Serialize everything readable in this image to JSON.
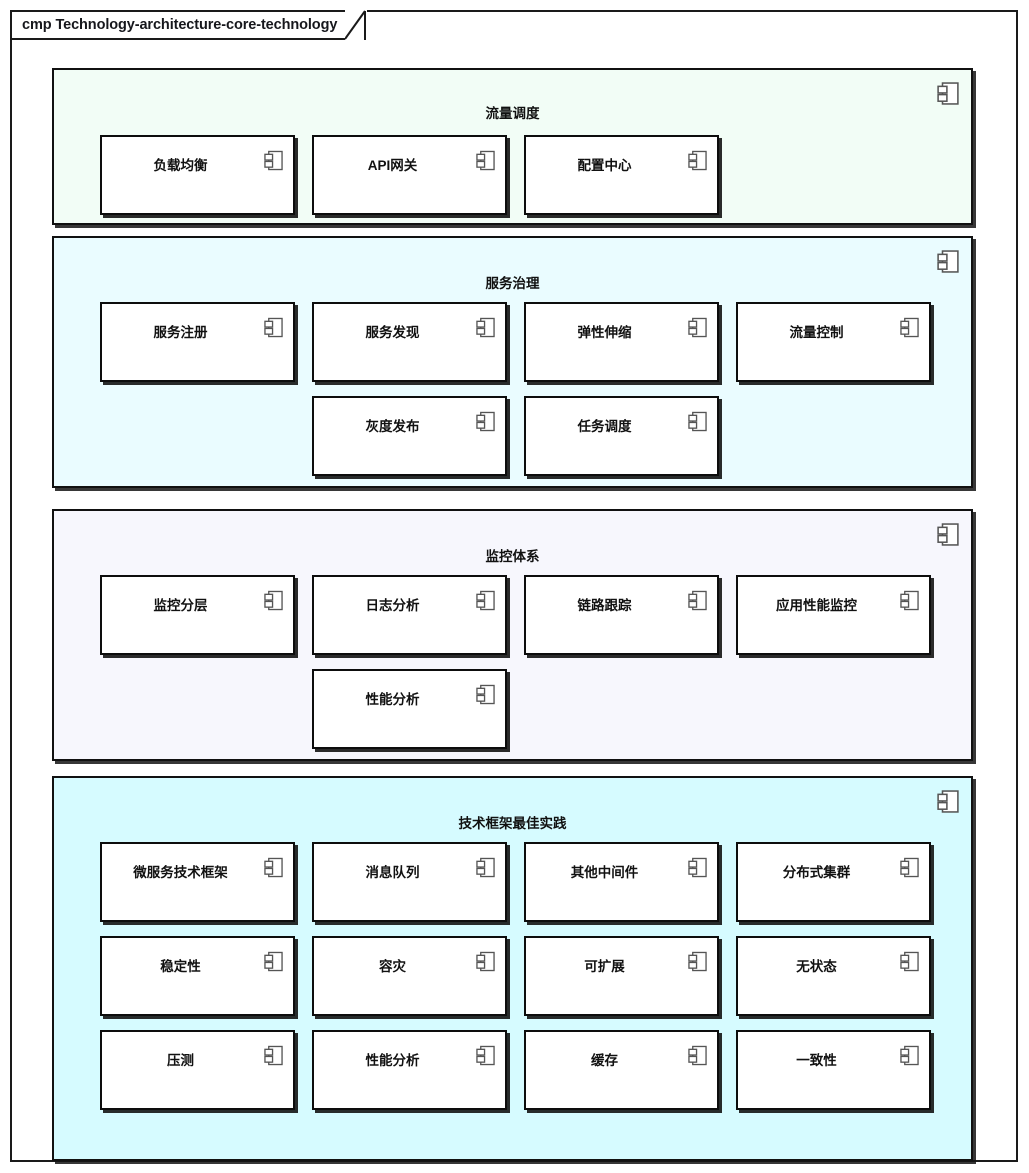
{
  "diagram": {
    "title": "cmp Technology-architecture-core-technology",
    "type": "uml-component-diagram",
    "icons": {
      "package_badge": "component-icon",
      "component_badge": "component-icon"
    },
    "colors": {
      "canvas": "#ffffff",
      "border": "#111111",
      "text": "#111111",
      "section_1_fill": "#f2fdf6",
      "section_2_fill": "#eafcff",
      "section_3_fill": "#f7f7fd",
      "section_4_fill": "#d6fbff"
    }
  },
  "sections": [
    {
      "id": "traffic-scheduling",
      "title": "流量调度",
      "fill": "#f2fdf6",
      "rows": [
        [
          "负载均衡",
          "API网关",
          "配置中心"
        ]
      ],
      "components": [
        "负载均衡",
        "API网关",
        "配置中心"
      ]
    },
    {
      "id": "service-governance",
      "title": "服务治理",
      "fill": "#eafcff",
      "rows": [
        [
          "服务注册",
          "服务发现",
          "弹性伸缩",
          "流量控制"
        ],
        [
          "灰度发布",
          "任务调度"
        ]
      ],
      "components": [
        "服务注册",
        "服务发现",
        "弹性伸缩",
        "流量控制",
        "灰度发布",
        "任务调度"
      ]
    },
    {
      "id": "monitoring-system",
      "title": "监控体系",
      "fill": "#f7f7fd",
      "rows": [
        [
          "监控分层",
          "日志分析",
          "链路跟踪",
          "应用性能监控"
        ],
        [
          "性能分析"
        ]
      ],
      "components": [
        "监控分层",
        "日志分析",
        "链路跟踪",
        "应用性能监控",
        "性能分析"
      ]
    },
    {
      "id": "tech-framework-best-practice",
      "title": "技术框架最佳实践",
      "fill": "#d6fbff",
      "rows": [
        [
          "微服务技术框架",
          "消息队列",
          "其他中间件",
          "分布式集群"
        ],
        [
          "稳定性",
          "容灾",
          "可扩展",
          "无状态"
        ],
        [
          "压测",
          "性能分析",
          "缓存",
          "一致性"
        ]
      ],
      "components": [
        "微服务技术框架",
        "消息队列",
        "其他中间件",
        "分布式集群",
        "稳定性",
        "容灾",
        "可扩展",
        "无状态",
        "压测",
        "性能分析",
        "缓存",
        "一致性"
      ]
    }
  ]
}
